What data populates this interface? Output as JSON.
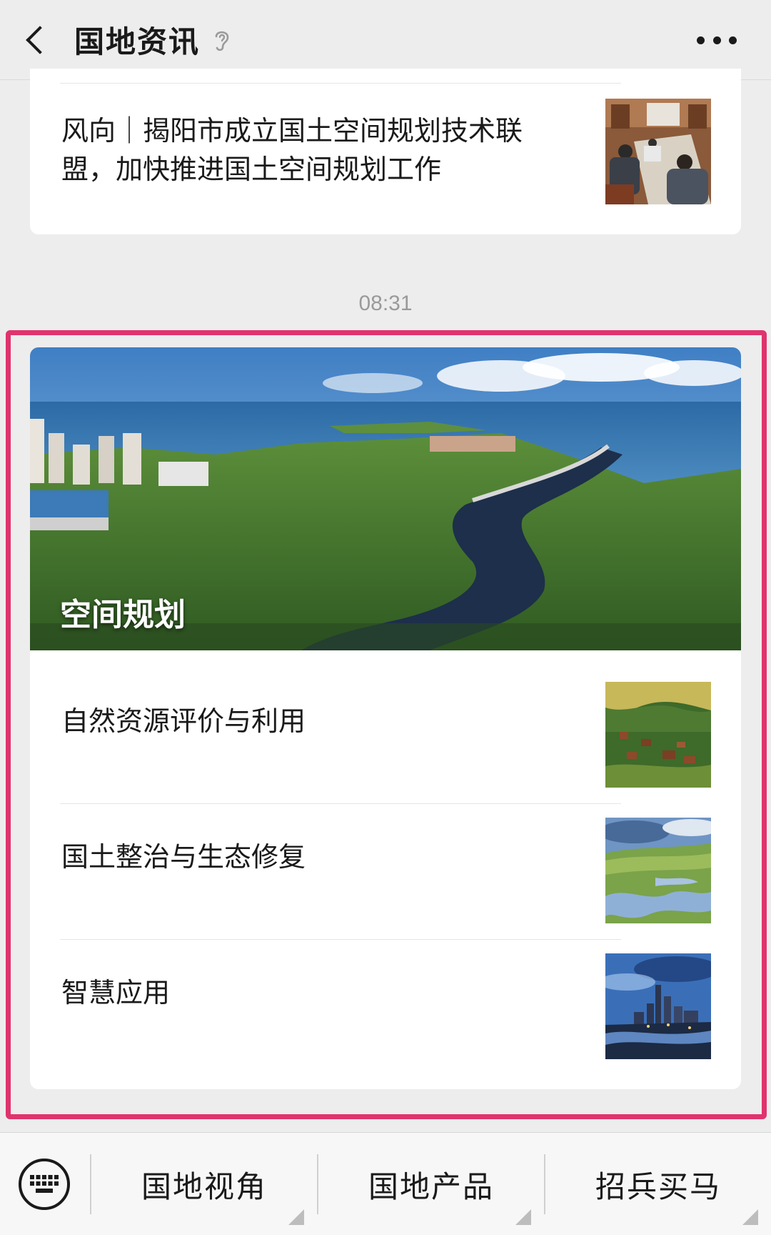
{
  "header": {
    "title": "国地资讯"
  },
  "previous_article": {
    "title": "风向｜揭阳市成立国土空间规划技术联盟，加快推进国土空间规划工作"
  },
  "timestamp": "08:31",
  "featured": {
    "hero_title": "空间规划",
    "items": [
      {
        "title": "自然资源评价与利用"
      },
      {
        "title": "国土整治与生态修复"
      },
      {
        "title": "智慧应用"
      }
    ]
  },
  "bottom_menu": {
    "items": [
      {
        "label": "国地视角"
      },
      {
        "label": "国地产品"
      },
      {
        "label": "招兵买马"
      }
    ]
  },
  "colors": {
    "highlight_border": "#e0336e",
    "background": "#ededed"
  },
  "icons": {
    "back": "chevron-left-icon",
    "ear": "ear-icon",
    "more": "more-dots-icon",
    "keyboard": "keyboard-icon"
  }
}
